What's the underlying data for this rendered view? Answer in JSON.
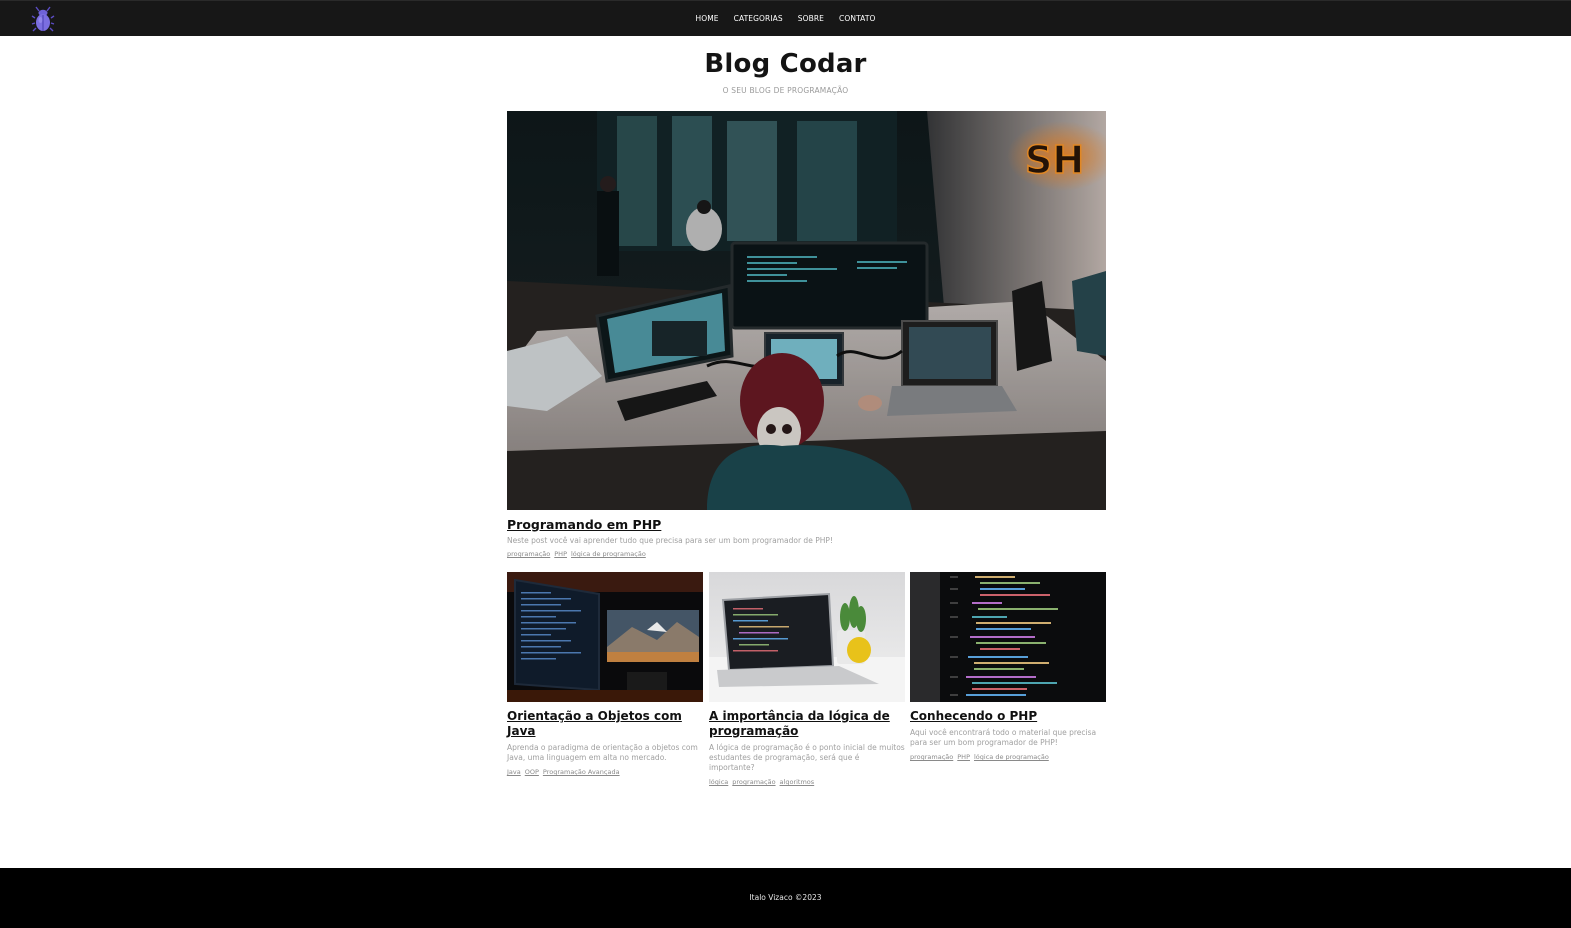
{
  "header": {
    "logo_icon": "bug-icon",
    "nav": [
      "HOME",
      "CATEGORIAS",
      "SOBRE",
      "CONTATO"
    ]
  },
  "site": {
    "title": "Blog Codar",
    "subtitle": "O SEU BLOG DE PROGRAMAÇÃO"
  },
  "featured": {
    "image_icon": "office-programmer-photo",
    "title": "Programando em PHP",
    "description": "Neste post você vai aprender tudo que precisa para ser um bom programador de PHP!",
    "tags": [
      "programação",
      "PHP",
      "lógica de programação"
    ]
  },
  "posts": [
    {
      "image_icon": "dual-monitor-code-photo",
      "title": "Orientação a Objetos com Java",
      "description": "Aprenda o paradigma de orientação a objetos com Java, uma linguagem em alta no mercado.",
      "tags": [
        "Java",
        "OOP",
        "Programação Avançada"
      ]
    },
    {
      "image_icon": "laptop-plant-photo",
      "title": "A importância da lógica de programação",
      "description": "A lógica de programação é o ponto inicial de muitos estudantes de programação, será que é importante?",
      "tags": [
        "lógica",
        "programação",
        "algoritmos"
      ]
    },
    {
      "image_icon": "code-screen-closeup-photo",
      "title": "Conhecendo o PHP",
      "description": "Aqui você encontrará todo o material que precisa para ser um bom programador de PHP!",
      "tags": [
        "programação",
        "PHP",
        "lógica de programação"
      ]
    }
  ],
  "footer": {
    "text": "Italo Vizaco ©2023"
  },
  "colors": {
    "header_bg": "#171717",
    "footer_bg": "#000000",
    "logo_purple": "#6a5acd"
  }
}
